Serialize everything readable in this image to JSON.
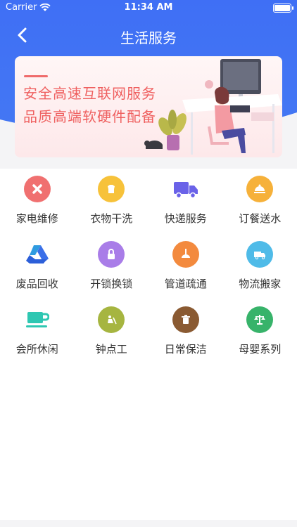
{
  "status": {
    "carrier": "Carrier",
    "time": "11:34 AM"
  },
  "nav": {
    "title": "生活服务"
  },
  "banner": {
    "line1": "安全高速互联网服务",
    "line2": "品质高端软硬件配备"
  },
  "services": [
    {
      "label": "家电维修",
      "icon": "tools-icon",
      "color": "#f07070"
    },
    {
      "label": "衣物干洗",
      "icon": "shirt-icon",
      "color": "#f7c23a"
    },
    {
      "label": "快递服务",
      "icon": "delivery-truck-icon",
      "color": "#6a62e8"
    },
    {
      "label": "订餐送水",
      "icon": "food-cloche-icon",
      "color": "#f6b13a"
    },
    {
      "label": "废品回收",
      "icon": "recycle-triangle-icon",
      "color": "#3a6fe8"
    },
    {
      "label": "开锁换锁",
      "icon": "lock-icon",
      "color": "#a97de8"
    },
    {
      "label": "管道疏通",
      "icon": "plunger-icon",
      "color": "#f38a3e"
    },
    {
      "label": "物流搬家",
      "icon": "moving-truck-icon",
      "color": "#4fbbe8"
    },
    {
      "label": "会所休闲",
      "icon": "coffee-cup-icon",
      "color": "#2ec7b2"
    },
    {
      "label": "钟点工",
      "icon": "cleaner-icon",
      "color": "#a6b540"
    },
    {
      "label": "日常保洁",
      "icon": "trash-icon",
      "color": "#8a5a32"
    },
    {
      "label": "母婴系列",
      "icon": "scale-icon",
      "color": "#37b36a"
    }
  ]
}
